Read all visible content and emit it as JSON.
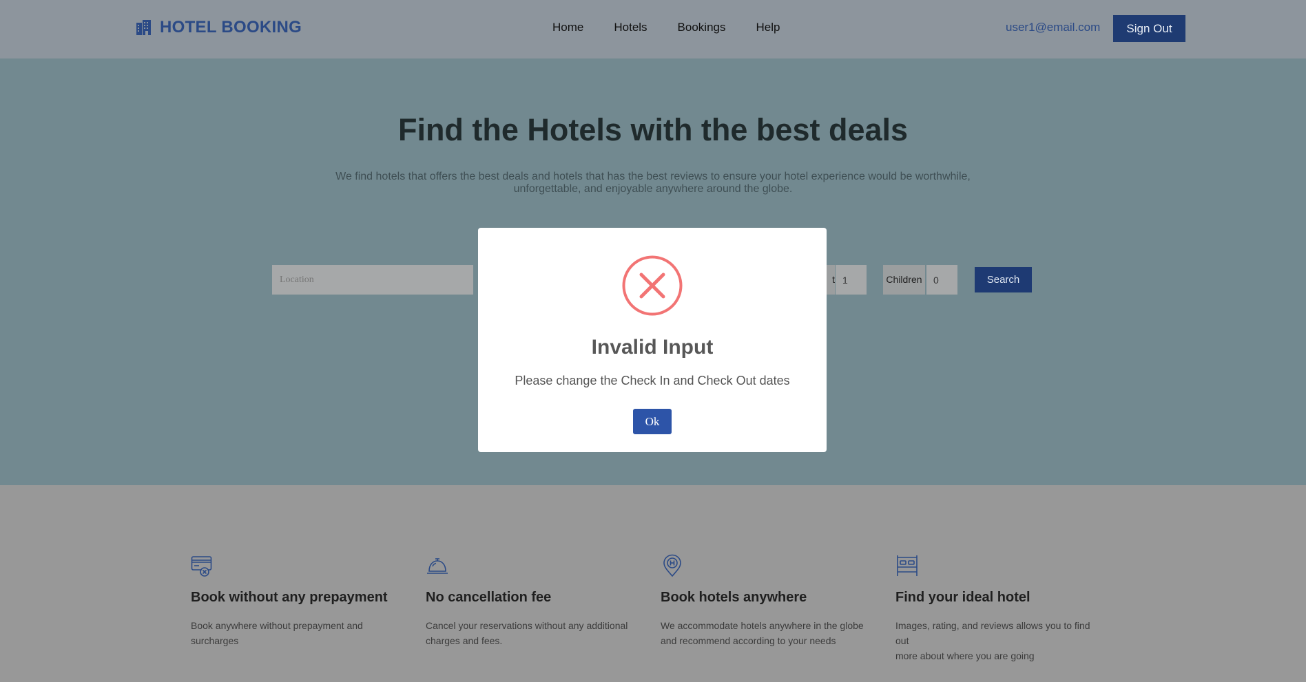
{
  "nav": {
    "brand": "HOTEL BOOKING",
    "links": [
      "Home",
      "Hotels",
      "Bookings",
      "Help"
    ],
    "user_email": "user1@email.com",
    "signout_label": "Sign Out"
  },
  "hero": {
    "title": "Find the Hotels with the best deals",
    "subtitle_line1": "We find hotels that offers the best deals and hotels that has the best reviews to ensure your hotel experience would be worthwhile,",
    "subtitle_line2": "unforgettable, and enjoyable anywhere around the globe."
  },
  "search": {
    "location_placeholder": "Location",
    "adults_label_fragment": "t",
    "adults_value": "1",
    "children_label": "Children",
    "children_value": "0",
    "search_label": "Search"
  },
  "features": [
    {
      "icon": "credit-card-icon",
      "title": "Book without any prepayment",
      "desc_line1": "Book anywhere without prepayment and",
      "desc_line2": "surcharges"
    },
    {
      "icon": "service-bell-icon",
      "title": "No cancellation fee",
      "desc_line1": "Cancel your reservations without any additional",
      "desc_line2": "charges and fees."
    },
    {
      "icon": "hotel-pin-icon",
      "title": "Book hotels anywhere",
      "desc_line1": "We accommodate hotels anywhere in the globe",
      "desc_line2": "and recommend according to your needs"
    },
    {
      "icon": "bed-icon",
      "title": "Find your ideal hotel",
      "desc_line1": "Images, rating, and reviews allows you to find out",
      "desc_line2": "more about where you are going"
    }
  ],
  "modal": {
    "icon": "error-x-icon",
    "title": "Invalid Input",
    "message": "Please change the Check In and Check Out dates",
    "ok_label": "Ok"
  },
  "colors": {
    "brand": "#2b4a86",
    "button": "#1f3b72",
    "error": "#f27474",
    "ok_button": "#2d54a8"
  }
}
